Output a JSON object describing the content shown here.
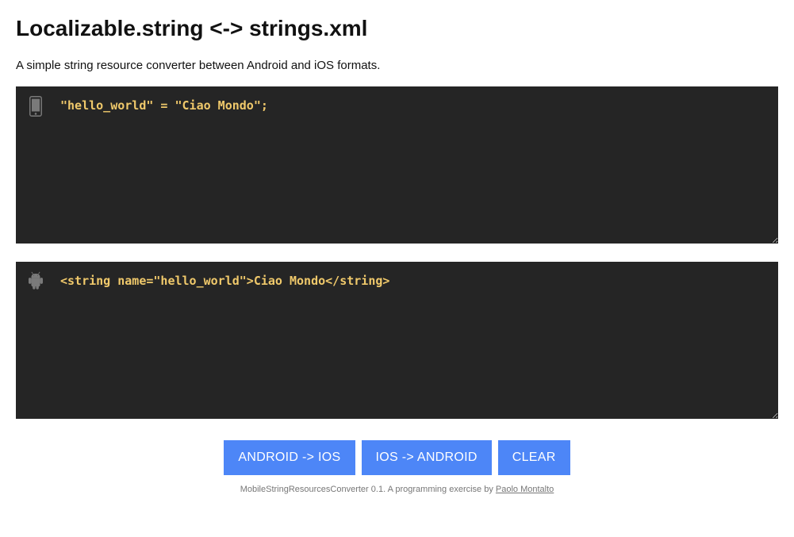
{
  "title": "Localizable.string <-> strings.xml",
  "subtitle": "A simple string resource converter between Android and iOS formats.",
  "ios_input": "\"hello_world\" = \"Ciao Mondo\";",
  "android_input": "<string name=\"hello_world\">Ciao Mondo</string>",
  "buttons": {
    "android_to_ios": "ANDROID -> IOS",
    "ios_to_android": "IOS -> ANDROID",
    "clear": "CLEAR"
  },
  "footer": {
    "text_prefix": "MobileStringResourcesConverter 0.1. A programming exercise by ",
    "author": "Paolo Montalto"
  }
}
